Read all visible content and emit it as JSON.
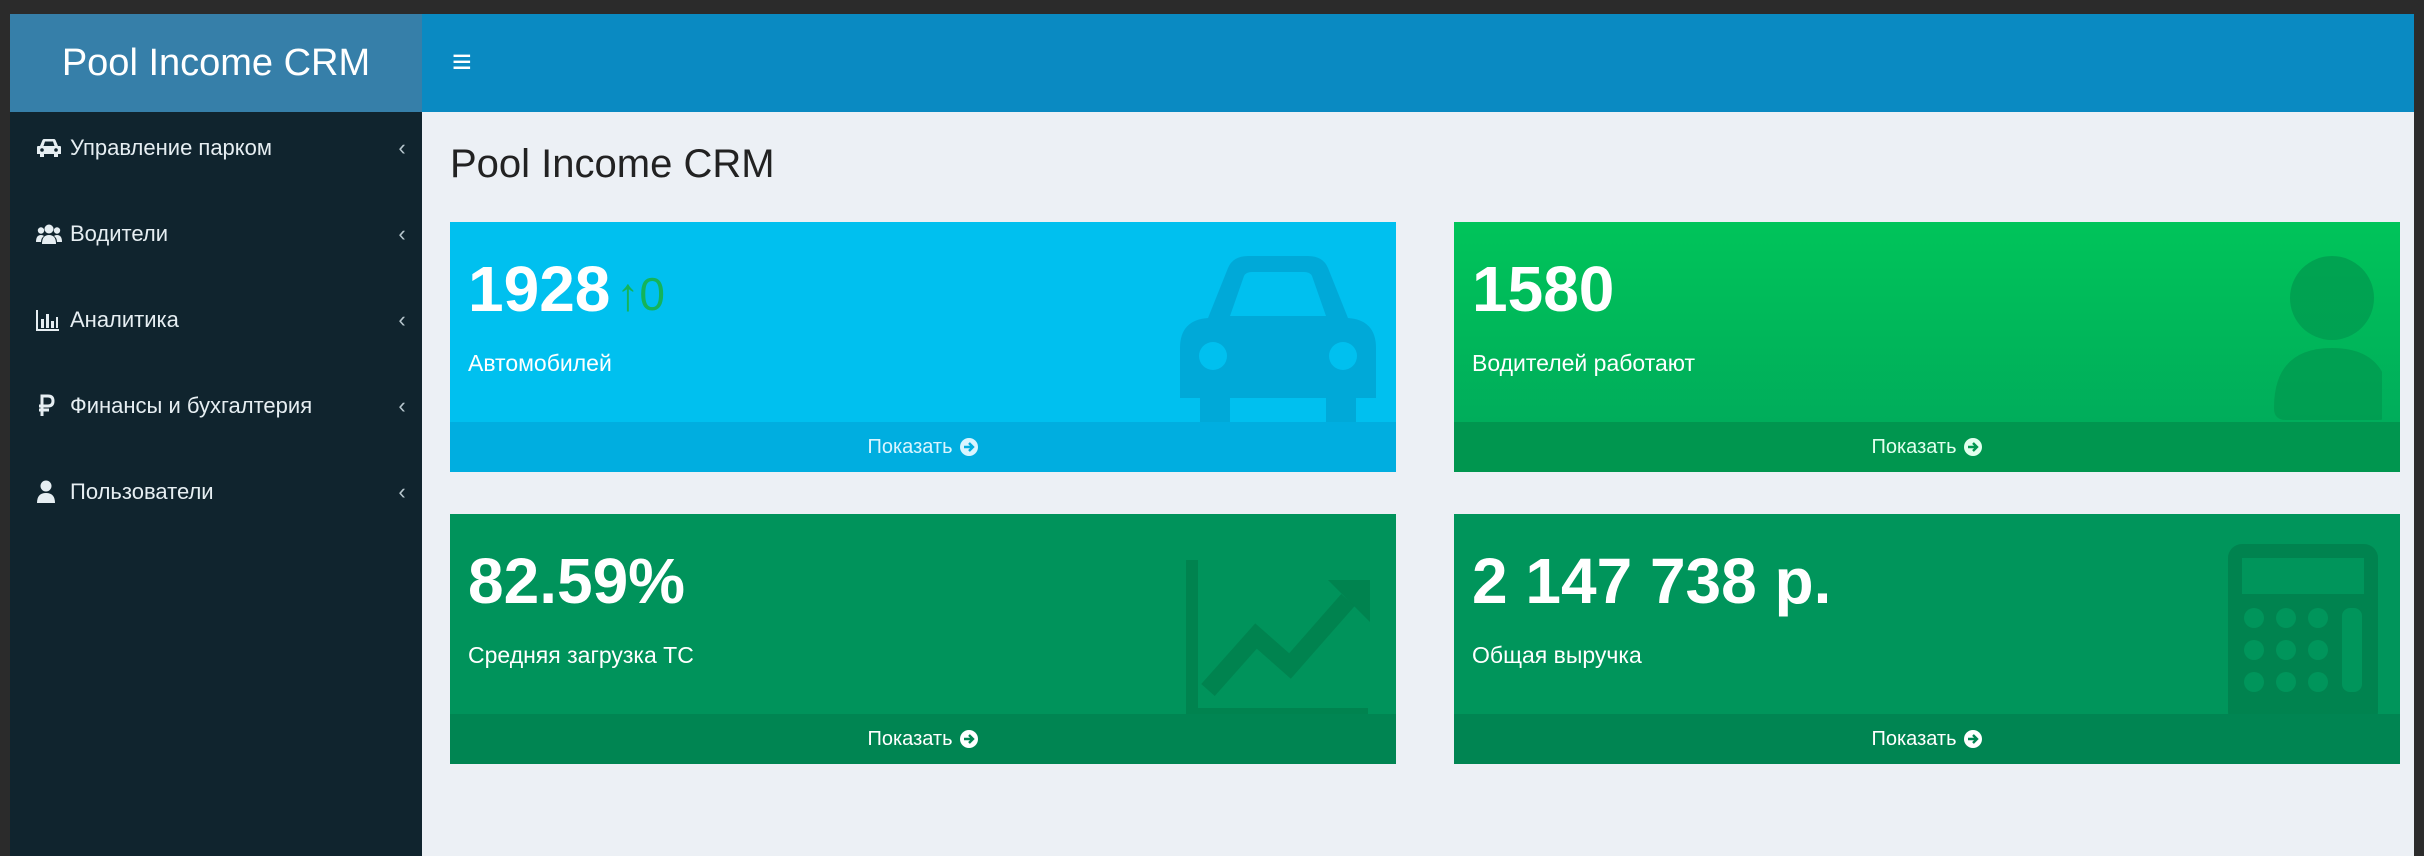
{
  "app": {
    "title": "Pool Income CRM",
    "menu_icon": "hamburger-icon"
  },
  "sidebar": {
    "items": [
      {
        "label": "Управление парком",
        "icon": "car-icon"
      },
      {
        "label": "Водители",
        "icon": "users-icon"
      },
      {
        "label": "Аналитика",
        "icon": "bar-chart-icon"
      },
      {
        "label": "Финансы и бухгалтерия",
        "icon": "ruble-icon"
      },
      {
        "label": "Пользователи",
        "icon": "user-icon"
      }
    ],
    "chevron": "‹"
  },
  "page": {
    "title": "Pool Income CRM"
  },
  "stats": {
    "cars": {
      "value": "1928",
      "trend_arrow": "↑",
      "trend_value": "0",
      "label": "Автомобилей",
      "footer": "Показать",
      "color": "#00c0ef",
      "icon": "car-icon"
    },
    "drivers": {
      "value": "1580",
      "label": "Водителей работают",
      "footer": "Показать",
      "color": "#00b45a",
      "icon": "user-icon"
    },
    "load": {
      "value": "82.59%",
      "label": "Средняя загрузка ТС",
      "footer": "Показать",
      "color": "#00935b",
      "icon": "line-chart-icon"
    },
    "revenue": {
      "value": "2 147 738 р.",
      "label": "Общая выручка",
      "footer": "Показать",
      "color": "#00955b",
      "icon": "calculator-icon"
    }
  },
  "colors": {
    "header": "#0a8ac2",
    "logo_bg": "#367fa9",
    "sidebar": "#10242e",
    "content_bg": "#ecf0f5",
    "trend": "#14b45a"
  }
}
